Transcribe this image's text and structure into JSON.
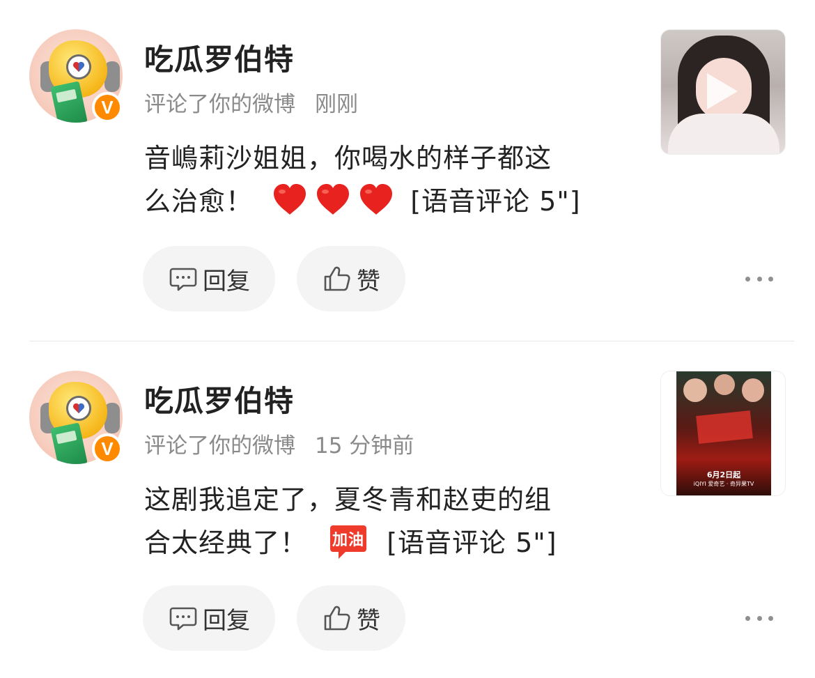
{
  "comments": [
    {
      "username": "吃瓜罗伯特",
      "action": "评论了你的微博",
      "time": "刚刚",
      "text_line1": "音嶋莉沙姐姐，你喝水的样子都这",
      "text_line2": "么治愈！",
      "emojis": [
        "heart",
        "heart",
        "heart"
      ],
      "voice": "[语音评论 5\"]",
      "thumbnail": "video",
      "badge": "V"
    },
    {
      "username": "吃瓜罗伯特",
      "action": "评论了你的微博",
      "time": "15 分钟前",
      "text_line1": "这剧我追定了，夏冬青和赵吏的组",
      "text_line2": "合太经典了！",
      "emojis": [
        "加油"
      ],
      "voice": "[语音评论 5\"]",
      "thumbnail": "poster",
      "poster_date": "6月2日起",
      "poster_brand": "iQIYI 爱奇艺 · 奇异果TV",
      "badge": "V"
    }
  ],
  "actions": {
    "reply": "回复",
    "like": "赞"
  },
  "colors": {
    "badge": "#ff8a00",
    "heart": "#e8231f",
    "button_bg": "#f4f4f4",
    "meta": "#8a8a8a"
  }
}
